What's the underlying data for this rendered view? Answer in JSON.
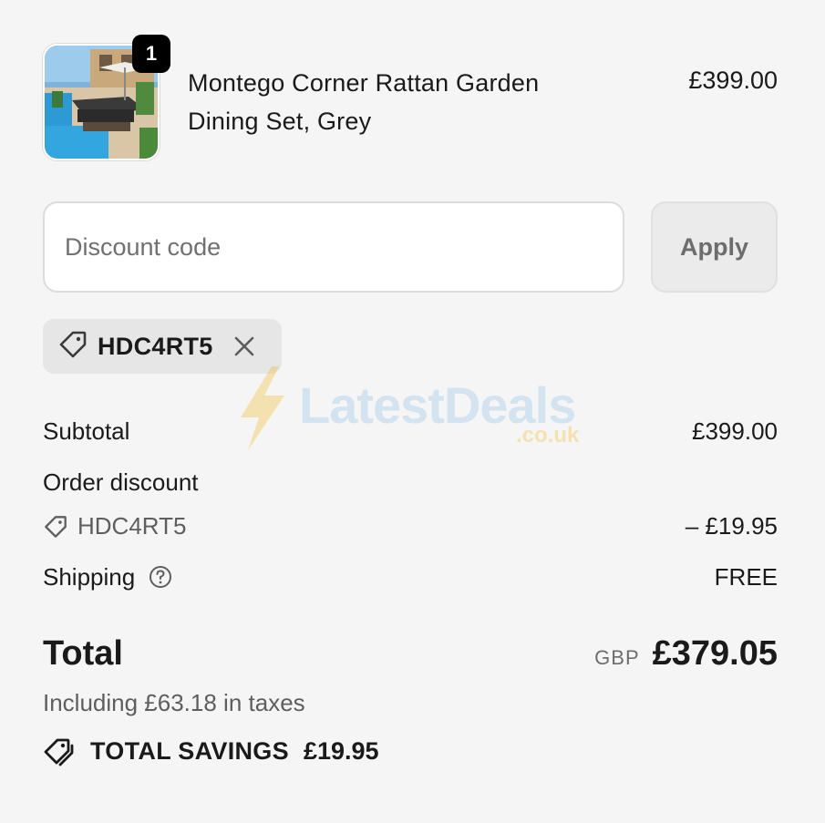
{
  "product": {
    "quantity": "1",
    "name": "Montego Corner Rattan Garden Dining Set, Grey",
    "price": "£399.00",
    "image_icon": "garden-furniture-photo"
  },
  "discount": {
    "placeholder": "Discount code",
    "apply_label": "Apply",
    "applied_code": "HDC4RT5"
  },
  "watermark": {
    "brand": "LatestDeals",
    "domain": ".co.uk"
  },
  "summary": {
    "subtotal_label": "Subtotal",
    "subtotal_value": "£399.00",
    "order_discount_label": "Order discount",
    "discount_code": "HDC4RT5",
    "discount_value": "– £19.95",
    "shipping_label": "Shipping",
    "shipping_value": "FREE",
    "total_label": "Total",
    "currency": "GBP",
    "total_value": "£379.05",
    "taxes_note": "Including £63.18 in taxes",
    "savings_label": "TOTAL SAVINGS",
    "savings_value": "£19.95"
  },
  "colors": {
    "background": "#f5f5f5",
    "text": "#1a1a1a",
    "muted": "#5e5e5e",
    "chip": "#e6e6e6"
  }
}
